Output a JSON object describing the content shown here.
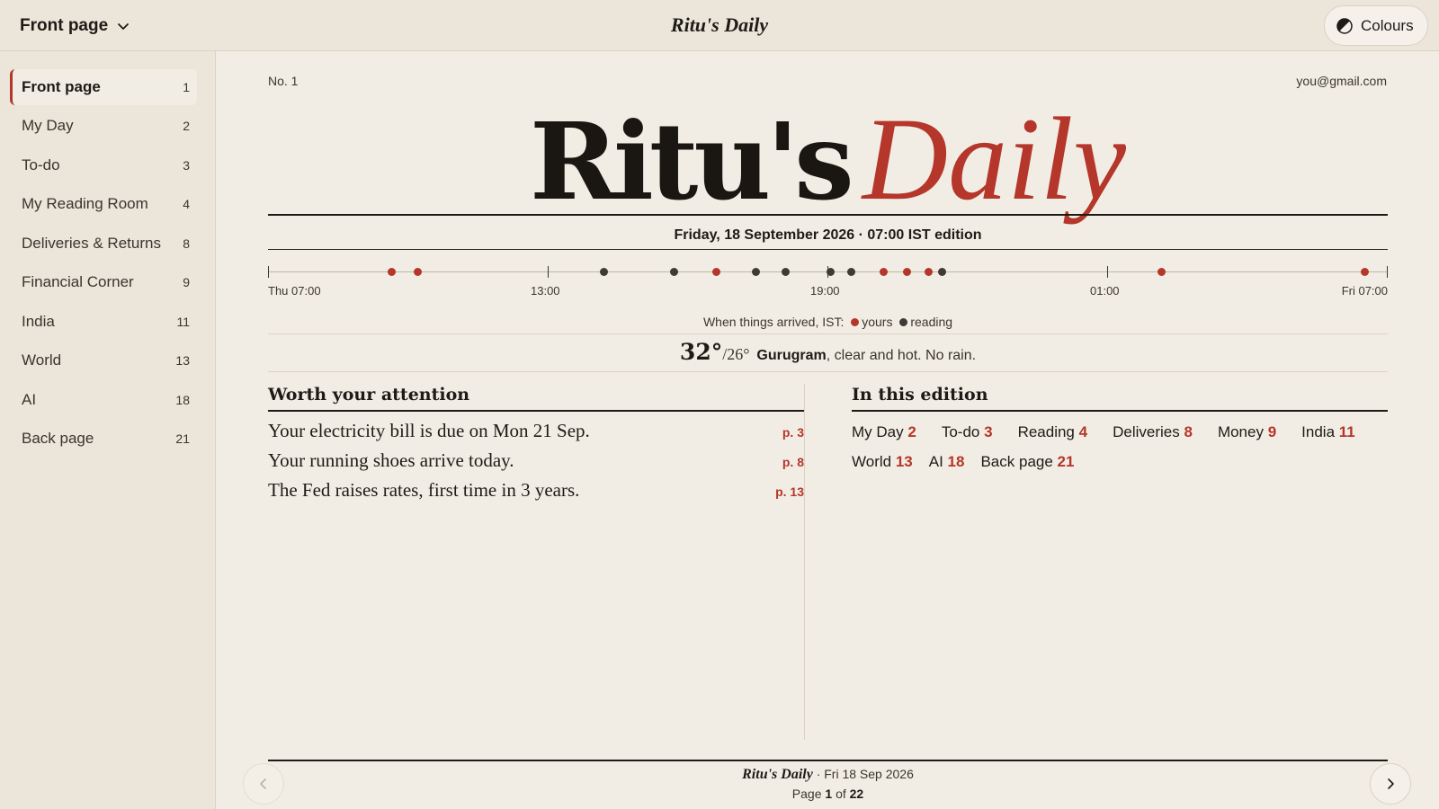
{
  "topbar": {
    "section_label": "Front page",
    "title": "Ritu's Daily",
    "colours_label": "Colours"
  },
  "sidebar": {
    "items": [
      {
        "label": "Front page",
        "page": "1"
      },
      {
        "label": "My Day",
        "page": "2"
      },
      {
        "label": "To-do",
        "page": "3"
      },
      {
        "label": "My Reading Room",
        "page": "4"
      },
      {
        "label": "Deliveries & Returns",
        "page": "8"
      },
      {
        "label": "Financial Corner",
        "page": "9"
      },
      {
        "label": "India",
        "page": "11"
      },
      {
        "label": "World",
        "page": "13"
      },
      {
        "label": "AI",
        "page": "18"
      },
      {
        "label": "Back page",
        "page": "21"
      }
    ]
  },
  "main": {
    "issue_no": "No. 1",
    "email": "you@gmail.com",
    "masthead_a": "Ritu's",
    "masthead_b": "Daily",
    "edition": "Friday, 18 September 2026 · 07:00 IST edition",
    "timeline": {
      "labels": [
        "Thu 07:00",
        "13:00",
        "19:00",
        "01:00",
        "Fri 07:00"
      ],
      "legend_prefix": "When things arrived, IST:",
      "legend_yours": "yours",
      "legend_reading": "reading",
      "arrivals": [
        {
          "hours": 2.65,
          "kind": "yours"
        },
        {
          "hours": 3.2,
          "kind": "yours"
        },
        {
          "hours": 7.2,
          "kind": "reading"
        },
        {
          "hours": 8.7,
          "kind": "reading"
        },
        {
          "hours": 9.6,
          "kind": "yours"
        },
        {
          "hours": 10.45,
          "kind": "reading"
        },
        {
          "hours": 11.1,
          "kind": "reading"
        },
        {
          "hours": 12.05,
          "kind": "reading"
        },
        {
          "hours": 12.5,
          "kind": "reading"
        },
        {
          "hours": 13.2,
          "kind": "yours"
        },
        {
          "hours": 13.7,
          "kind": "yours"
        },
        {
          "hours": 14.15,
          "kind": "yours"
        },
        {
          "hours": 14.45,
          "kind": "reading"
        },
        {
          "hours": 19.15,
          "kind": "yours"
        },
        {
          "hours": 23.5,
          "kind": "yours"
        }
      ]
    },
    "weather": {
      "high": "32°",
      "low": "/26°",
      "city": "Gurugram",
      "summary": ", clear and hot. No rain."
    },
    "attention": {
      "heading": "Worth your attention",
      "stories": [
        {
          "text": "Your electricity bill is due on Mon 21 Sep.",
          "page": "p. 3"
        },
        {
          "text": "Your running shoes arrive today.",
          "page": "p. 8"
        },
        {
          "text": "The Fed raises rates, first time in 3 years.",
          "page": "p. 13"
        }
      ]
    },
    "contents": {
      "heading": "In this edition",
      "items": [
        {
          "label": "My Day",
          "page": "2"
        },
        {
          "label": "To-do",
          "page": "3"
        },
        {
          "label": "Reading",
          "page": "4"
        },
        {
          "label": "Deliveries",
          "page": "8"
        },
        {
          "label": "Money",
          "page": "9"
        },
        {
          "label": "India",
          "page": "11"
        },
        {
          "label": "World",
          "page": "13"
        },
        {
          "label": "AI",
          "page": "18"
        },
        {
          "label": "Back page",
          "page": "21"
        }
      ]
    },
    "footer": {
      "title": "Ritu's Daily",
      "date": "· Fri 18 Sep 2026",
      "page_word": "Page",
      "page_current": "1",
      "of_word": "of",
      "page_total": "22"
    }
  },
  "colors": {
    "accent": "#b5362a",
    "ink": "#1e1b17",
    "paper": "#f2ede4",
    "sidebar": "#ebe5da"
  }
}
